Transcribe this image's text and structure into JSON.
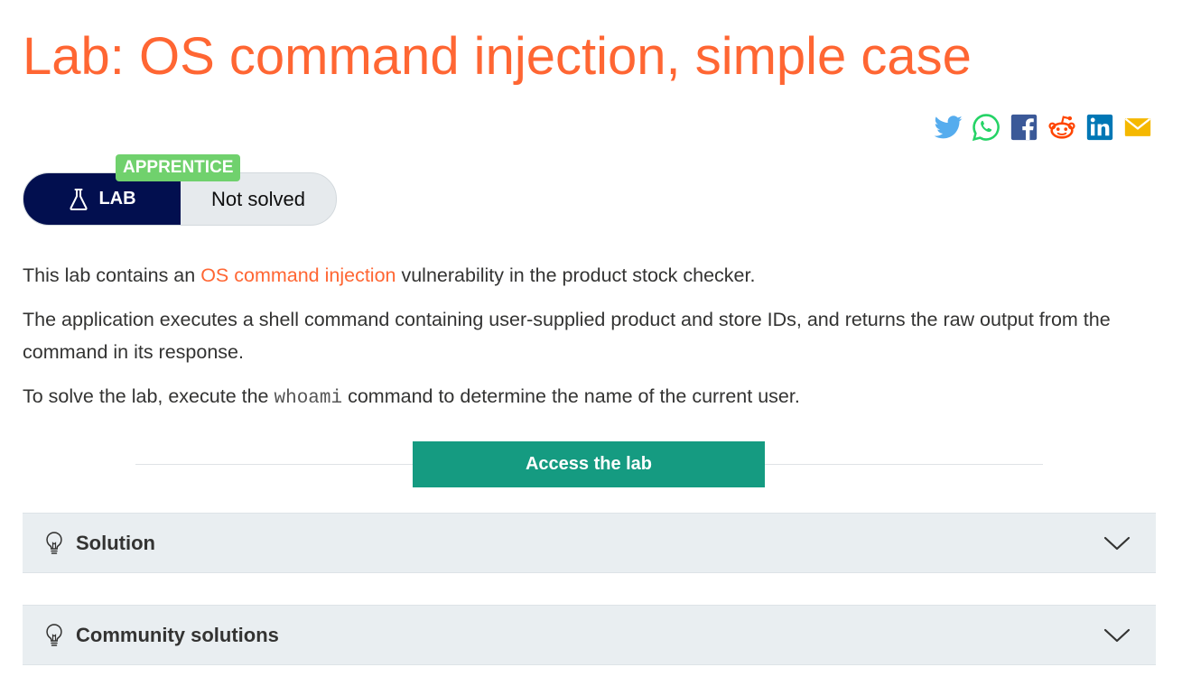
{
  "page": {
    "title": "Lab: OS command injection, simple case"
  },
  "share": {
    "items": [
      {
        "name": "twitter-icon",
        "color": "#55acee"
      },
      {
        "name": "whatsapp-icon",
        "color": "#25d366"
      },
      {
        "name": "facebook-icon",
        "color": "#3b5998"
      },
      {
        "name": "reddit-icon",
        "color": "#ff4500"
      },
      {
        "name": "linkedin-icon",
        "color": "#0077b5"
      },
      {
        "name": "email-icon",
        "color": "#f5b800"
      }
    ]
  },
  "badge": {
    "level": "APPRENTICE",
    "type_label": "LAB",
    "status": "Not solved",
    "colors": {
      "level": "#70d16d",
      "type_bg": "#020f4f"
    }
  },
  "description": {
    "p1_before": "This lab contains an ",
    "p1_link": "OS command injection",
    "p1_after": " vulnerability in the product stock checker.",
    "p2": "The application executes a shell command containing user-supplied product and store IDs, and returns the raw output from the command in its response.",
    "p3_before": "To solve the lab, execute the ",
    "p3_code": "whoami",
    "p3_after": " command to determine the name of the current user."
  },
  "access": {
    "label": "Access the lab",
    "color": "#159b81"
  },
  "accordions": [
    {
      "label": "Solution",
      "icon": "lightbulb-icon"
    },
    {
      "label": "Community solutions",
      "icon": "lightbulb-icon"
    }
  ],
  "colors": {
    "accent": "#ff6633",
    "text": "#333332",
    "panel": "#e9eef1"
  }
}
